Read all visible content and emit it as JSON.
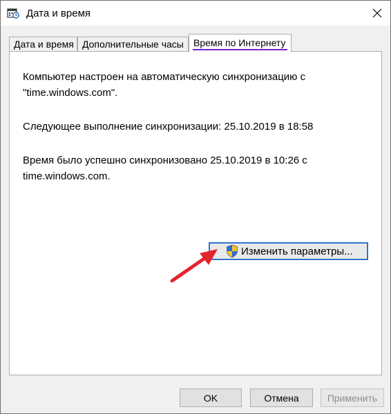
{
  "window": {
    "title": "Дата и время",
    "close_glyph": "✕"
  },
  "tabs": [
    {
      "label": "Дата и время",
      "active": false
    },
    {
      "label": "Дополнительные часы",
      "active": false
    },
    {
      "label": "Время по Интернету",
      "active": true
    }
  ],
  "panel": {
    "sync_config_line1": "Компьютер настроен на автоматическую синхронизацию с",
    "sync_config_line2": "\"time.windows.com\".",
    "next_sync": "Следующее выполнение синхронизации: 25.10.2019 в 18:58",
    "last_sync_line1": "Время было успешно синхронизовано 25.10.2019 в 10:26 с",
    "last_sync_line2": "time.windows.com.",
    "change_settings_label": "Изменить параметры..."
  },
  "footer": {
    "ok_label": "OK",
    "cancel_label": "Отмена",
    "apply_label": "Применить",
    "apply_enabled": false
  },
  "colors": {
    "accent_underline": "#7a22c9",
    "focus_border": "#2e76c9",
    "annotation_arrow": "#e5232b"
  },
  "icons": [
    "clock-calendar-icon",
    "close-icon",
    "uac-shield-icon",
    "annotation-arrow"
  ]
}
